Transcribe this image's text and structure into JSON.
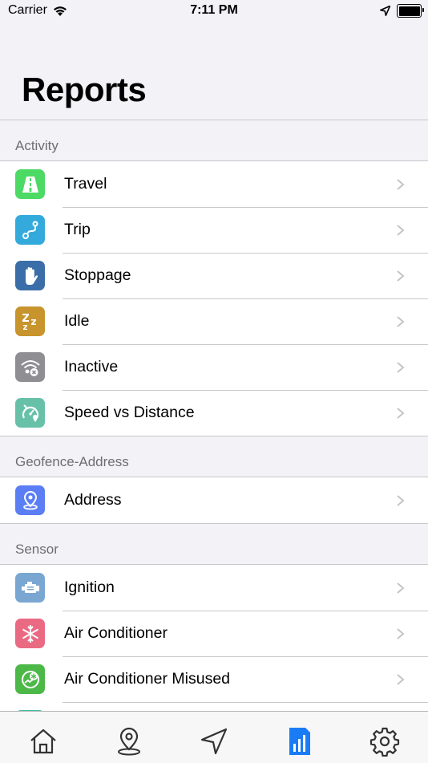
{
  "status_bar": {
    "carrier": "Carrier",
    "time": "7:11 PM"
  },
  "nav": {
    "title": "Reports"
  },
  "sections": [
    {
      "header": "Activity",
      "items": [
        {
          "label": "Travel",
          "icon": "road-icon",
          "color": "#4cd964"
        },
        {
          "label": "Trip",
          "icon": "route-icon",
          "color": "#34aadc"
        },
        {
          "label": "Stoppage",
          "icon": "hand-stop-icon",
          "color": "#3b6ea8"
        },
        {
          "label": "Idle",
          "icon": "sleep-zzz-icon",
          "color": "#c8942e"
        },
        {
          "label": "Inactive",
          "icon": "no-signal-icon",
          "color": "#8e8e93"
        },
        {
          "label": "Speed vs Distance",
          "icon": "speedometer-location-icon",
          "color": "#67c1a8"
        }
      ]
    },
    {
      "header": "Geofence-Address",
      "items": [
        {
          "label": "Address",
          "icon": "location-pin-icon",
          "color": "#5b7ef5"
        }
      ]
    },
    {
      "header": "Sensor",
      "items": [
        {
          "label": "Ignition",
          "icon": "engine-icon",
          "color": "#7aa7d1"
        },
        {
          "label": "Air Conditioner",
          "icon": "snowflake-icon",
          "color": "#ea6a83"
        },
        {
          "label": "Air Conditioner Misused",
          "icon": "ac-misuse-icon",
          "color": "#4cb848"
        }
      ]
    }
  ],
  "tab_bar": {
    "active_color": "#1a7cf5",
    "inactive_color": "#333333",
    "tabs": [
      "home-icon",
      "map-pin-icon",
      "navigation-arrow-icon",
      "reports-icon",
      "settings-gear-icon"
    ],
    "active_index": 3
  }
}
